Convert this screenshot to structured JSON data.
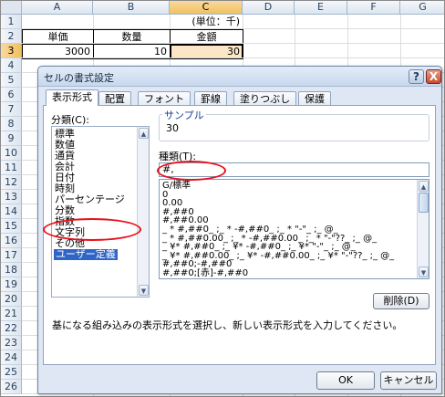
{
  "sheet": {
    "columns": [
      "A",
      "B",
      "C",
      "D",
      "E",
      "F",
      "G"
    ],
    "rows": [
      "1",
      "2",
      "3",
      "4",
      "5",
      "6",
      "7",
      "8",
      "9",
      "10",
      "11",
      "12",
      "13",
      "14",
      "15",
      "16",
      "17",
      "18",
      "19",
      "20",
      "21",
      "22",
      "23",
      "24",
      "25",
      "26"
    ],
    "unit_label": "(単位：千)",
    "header_unit_price": "単価",
    "header_quantity": "数量",
    "header_amount": "金額",
    "value_unit_price": "3000",
    "value_quantity": "10",
    "value_amount": "30"
  },
  "dialog": {
    "title": "セルの書式設定",
    "help": "?",
    "close": "X",
    "tabs": [
      "表示形式",
      "配置",
      "フォント",
      "罫線",
      "塗りつぶし",
      "保護"
    ],
    "category_label": "分類(C):",
    "categories": [
      "標準",
      "数値",
      "通貨",
      "会計",
      "日付",
      "時刻",
      "パーセンテージ",
      "分数",
      "指数",
      "文字列",
      "その他",
      "ユーザー定義"
    ],
    "selected_category": "ユーザー定義",
    "sample_label": "サンプル",
    "sample_value": "30",
    "type_label": "種類(T):",
    "type_value": "#,",
    "formats": [
      "G/標準",
      "0",
      "0.00",
      "#,##0",
      "#,##0.00",
      "_ * #,##0_ ;_ * -#,##0_ ;_ * \"-\"_ ;_ @_",
      "_ * #,##0.00_ ;_ * -#,##0.00_ ;_ * \"-\"??_ ;_ @_",
      "_ ¥* #,##0_ ;_ ¥* -#,##0_ ;_ ¥* \"-\"_ ;_ @_",
      "_ ¥* #,##0.00_ ;_ ¥* -#,##0.00_ ;_ ¥* \"-\"??_ ;_ @_",
      "#,##0;-#,##0",
      "#,##0;[赤]-#,##0"
    ],
    "delete_button": "削除(D)",
    "description": "基になる組み込みの表示形式を選択し、新しい表示形式を入力してください。",
    "ok_button": "OK",
    "cancel_button": "キャンセル"
  },
  "colors": {
    "highlight_ring": "#e8101b",
    "selection": "#3165c5",
    "selected_header": "#f1c15f"
  }
}
